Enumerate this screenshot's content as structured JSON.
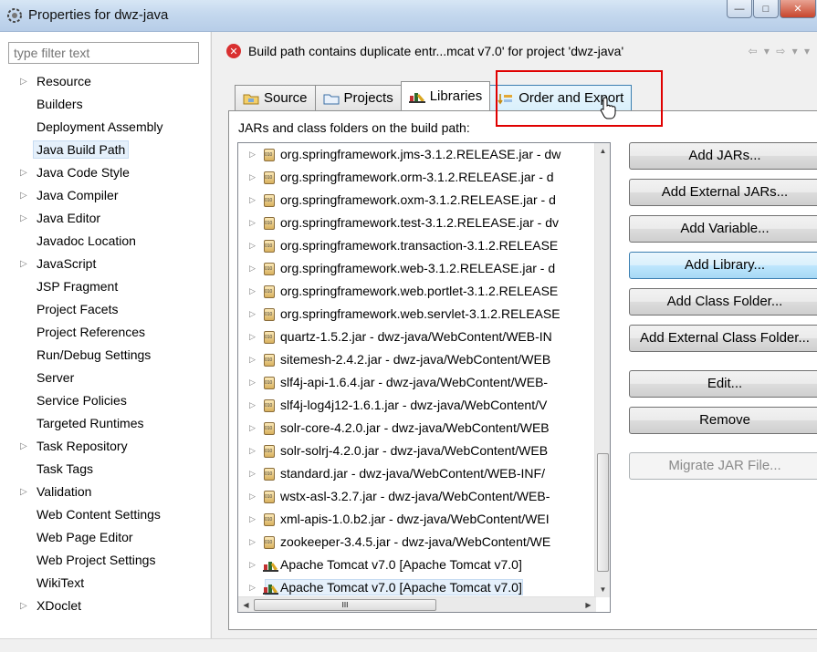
{
  "window": {
    "title": "Properties for dwz-java",
    "controls": [
      "minimize",
      "maximize",
      "close"
    ]
  },
  "filter": {
    "placeholder": "type filter text"
  },
  "sidebar": {
    "items": [
      {
        "label": "Resource",
        "expandable": true
      },
      {
        "label": "Builders",
        "expandable": false
      },
      {
        "label": "Deployment Assembly",
        "expandable": false
      },
      {
        "label": "Java Build Path",
        "expandable": false,
        "selected": true
      },
      {
        "label": "Java Code Style",
        "expandable": true
      },
      {
        "label": "Java Compiler",
        "expandable": true
      },
      {
        "label": "Java Editor",
        "expandable": true
      },
      {
        "label": "Javadoc Location",
        "expandable": false
      },
      {
        "label": "JavaScript",
        "expandable": true
      },
      {
        "label": "JSP Fragment",
        "expandable": false
      },
      {
        "label": "Project Facets",
        "expandable": false
      },
      {
        "label": "Project References",
        "expandable": false
      },
      {
        "label": "Run/Debug Settings",
        "expandable": false
      },
      {
        "label": "Server",
        "expandable": false
      },
      {
        "label": "Service Policies",
        "expandable": false
      },
      {
        "label": "Targeted Runtimes",
        "expandable": false
      },
      {
        "label": "Task Repository",
        "expandable": true
      },
      {
        "label": "Task Tags",
        "expandable": false
      },
      {
        "label": "Validation",
        "expandable": true
      },
      {
        "label": "Web Content Settings",
        "expandable": false
      },
      {
        "label": "Web Page Editor",
        "expandable": false
      },
      {
        "label": "Web Project Settings",
        "expandable": false
      },
      {
        "label": "WikiText",
        "expandable": false
      },
      {
        "label": "XDoclet",
        "expandable": true
      }
    ]
  },
  "message": {
    "text": "Build path contains duplicate entr...mcat v7.0' for project 'dwz-java'",
    "icon": "error-icon"
  },
  "tabs": [
    {
      "label": "Source",
      "icon": "source-folder-icon"
    },
    {
      "label": "Projects",
      "icon": "projects-icon"
    },
    {
      "label": "Libraries",
      "icon": "libraries-icon",
      "active": true
    },
    {
      "label": "Order and Export",
      "icon": "order-export-icon",
      "hover": true
    }
  ],
  "libraries": {
    "caption": "JARs and class folders on the build path:",
    "entries": [
      {
        "label": "org.springframework.jms-3.1.2.RELEASE.jar - dw",
        "kind": "jar"
      },
      {
        "label": "org.springframework.orm-3.1.2.RELEASE.jar - d",
        "kind": "jar"
      },
      {
        "label": "org.springframework.oxm-3.1.2.RELEASE.jar - d",
        "kind": "jar"
      },
      {
        "label": "org.springframework.test-3.1.2.RELEASE.jar - dv",
        "kind": "jar"
      },
      {
        "label": "org.springframework.transaction-3.1.2.RELEASE",
        "kind": "jar"
      },
      {
        "label": "org.springframework.web-3.1.2.RELEASE.jar - d",
        "kind": "jar"
      },
      {
        "label": "org.springframework.web.portlet-3.1.2.RELEASE",
        "kind": "jar"
      },
      {
        "label": "org.springframework.web.servlet-3.1.2.RELEASE",
        "kind": "jar"
      },
      {
        "label": "quartz-1.5.2.jar - dwz-java/WebContent/WEB-IN",
        "kind": "jar"
      },
      {
        "label": "sitemesh-2.4.2.jar - dwz-java/WebContent/WEB",
        "kind": "jar"
      },
      {
        "label": "slf4j-api-1.6.4.jar - dwz-java/WebContent/WEB-",
        "kind": "jar"
      },
      {
        "label": "slf4j-log4j12-1.6.1.jar - dwz-java/WebContent/V",
        "kind": "jar"
      },
      {
        "label": "solr-core-4.2.0.jar - dwz-java/WebContent/WEB",
        "kind": "jar"
      },
      {
        "label": "solr-solrj-4.2.0.jar - dwz-java/WebContent/WEB",
        "kind": "jar"
      },
      {
        "label": "standard.jar - dwz-java/WebContent/WEB-INF/",
        "kind": "jar"
      },
      {
        "label": "wstx-asl-3.2.7.jar - dwz-java/WebContent/WEB-",
        "kind": "jar"
      },
      {
        "label": "xml-apis-1.0.b2.jar - dwz-java/WebContent/WEI",
        "kind": "jar"
      },
      {
        "label": "zookeeper-3.4.5.jar - dwz-java/WebContent/WE",
        "kind": "jar"
      },
      {
        "label": "Apache Tomcat v7.0 [Apache Tomcat v7.0]",
        "kind": "library"
      },
      {
        "label": "Apache Tomcat v7.0 [Apache Tomcat v7.0]",
        "kind": "library",
        "selected": true
      }
    ]
  },
  "buttons": {
    "add_jars": "Add JARs...",
    "add_external_jars": "Add External JARs...",
    "add_variable": "Add Variable...",
    "add_library": "Add Library...",
    "add_class_folder": "Add Class Folder...",
    "add_external_class_folder": "Add External Class Folder...",
    "edit": "Edit...",
    "remove": "Remove",
    "migrate_jar": "Migrate JAR File..."
  },
  "scrollbar": {
    "h_thumb_grip": "III"
  },
  "colors": {
    "highlight_box": "#e00000",
    "selection": "#e5f0fb",
    "hover_tab": "#d9f0fc"
  }
}
